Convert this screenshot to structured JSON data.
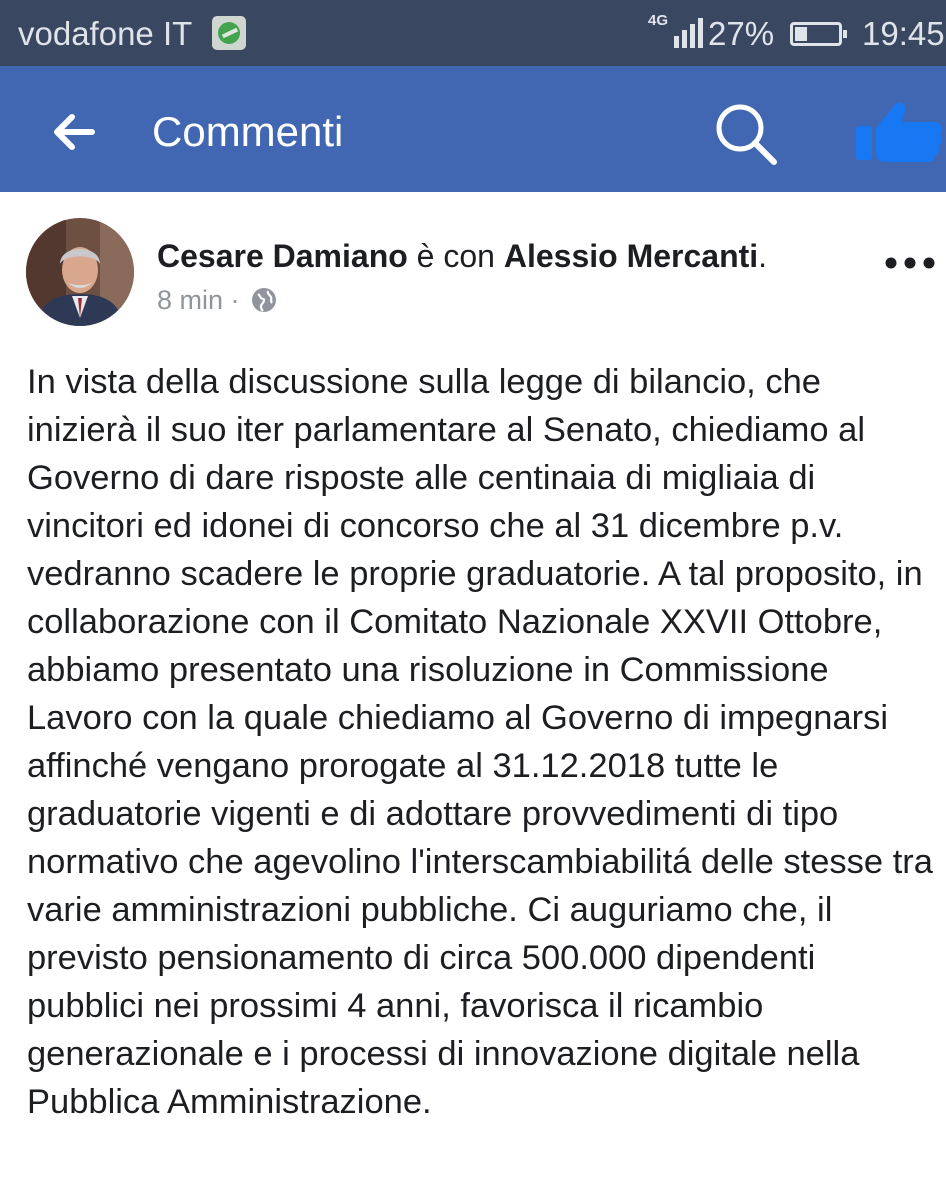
{
  "status_bar": {
    "carrier": "vodafone IT",
    "network": "4G",
    "battery_percent": "27%",
    "battery_level": 0.27,
    "time": "19:45",
    "icons": [
      "app-notification-icon",
      "signal-icon",
      "battery-icon"
    ]
  },
  "app_bar": {
    "title": "Commenti",
    "background_color": "#4267b2",
    "icons": [
      "back-arrow-icon",
      "search-icon",
      "like-icon"
    ]
  },
  "post": {
    "author": "Cesare Damiano",
    "with_text": "è con",
    "tagged": "Alessio Mercanti",
    "period": ".",
    "time_ago": "8 min",
    "separator": "·",
    "privacy_icon": "globe-icon",
    "body": "In vista della discussione sulla legge di bilancio, che inizierà il suo iter parlamentare al Senato, chiediamo al Governo di dare risposte alle centinaia di migliaia di vincitori ed idonei di concorso che al 31 dicembre p.v. vedranno scadere le proprie graduatorie. A tal proposito, in collaborazione con il Comitato Nazionale XXVII Ottobre, abbiamo presentato una risoluzione in Commissione Lavoro con la quale chiediamo al Governo di impegnarsi affinché vengano prorogate al 31.12.2018 tutte le graduatorie vigenti e di adottare provvedimenti di tipo normativo che agevolino l'interscambiabilitá delle stesse tra varie amministrazioni pubbliche. Ci auguriamo che, il previsto pensionamento di circa 500.000 dipendenti pubblici nei prossimi 4 anni, favorisca il ricambio generazionale e i processi di innovazione digitale nella Pubblica Amministrazione."
  }
}
